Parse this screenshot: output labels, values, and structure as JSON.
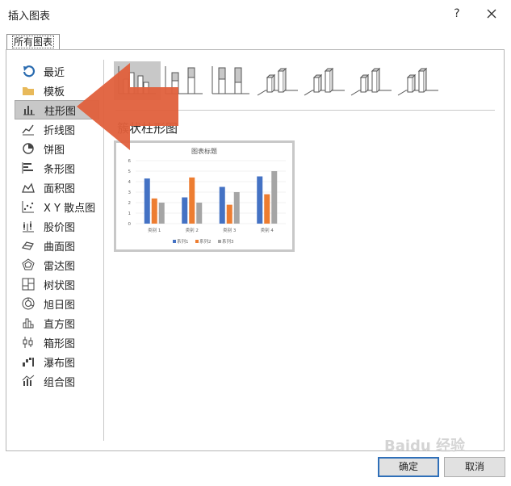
{
  "window": {
    "title": "插入图表",
    "help_label": "?"
  },
  "tabs": [
    {
      "label": "所有图表"
    }
  ],
  "sidebar": {
    "items": [
      {
        "label": "最近",
        "icon": "recent-icon"
      },
      {
        "label": "模板",
        "icon": "template-folder-icon"
      },
      {
        "label": "柱形图",
        "icon": "column-chart-icon",
        "selected": true
      },
      {
        "label": "折线图",
        "icon": "line-chart-icon"
      },
      {
        "label": "饼图",
        "icon": "pie-chart-icon"
      },
      {
        "label": "条形图",
        "icon": "bar-chart-icon"
      },
      {
        "label": "面积图",
        "icon": "area-chart-icon"
      },
      {
        "label": "X Y 散点图",
        "icon": "scatter-chart-icon"
      },
      {
        "label": "股价图",
        "icon": "stock-chart-icon"
      },
      {
        "label": "曲面图",
        "icon": "surface-chart-icon"
      },
      {
        "label": "雷达图",
        "icon": "radar-chart-icon"
      },
      {
        "label": "树状图",
        "icon": "treemap-chart-icon"
      },
      {
        "label": "旭日图",
        "icon": "sunburst-chart-icon"
      },
      {
        "label": "直方图",
        "icon": "histogram-chart-icon"
      },
      {
        "label": "箱形图",
        "icon": "box-whisker-chart-icon"
      },
      {
        "label": "瀑布图",
        "icon": "waterfall-chart-icon"
      },
      {
        "label": "组合图",
        "icon": "combo-chart-icon"
      }
    ]
  },
  "main": {
    "chart_type_title": "簇状柱形图",
    "subtypes": [
      {
        "name": "clustered-column",
        "selected": true
      },
      {
        "name": "stacked-column"
      },
      {
        "name": "100-stacked-column"
      },
      {
        "name": "3d-clustered-column"
      },
      {
        "name": "3d-stacked-column"
      },
      {
        "name": "3d-100-stacked-column"
      },
      {
        "name": "3d-column"
      }
    ]
  },
  "chart_data": {
    "type": "bar",
    "title": "图表标题",
    "categories": [
      "类别 1",
      "类别 2",
      "类别 3",
      "类别 4"
    ],
    "series": [
      {
        "name": "系列1",
        "values": [
          4.3,
          2.5,
          3.5,
          4.5
        ],
        "color": "#4472c4"
      },
      {
        "name": "系列2",
        "values": [
          2.4,
          4.4,
          1.8,
          2.8
        ],
        "color": "#ed7d31"
      },
      {
        "name": "系列3",
        "values": [
          2,
          2,
          3,
          5
        ],
        "color": "#a5a5a5"
      }
    ],
    "yticks": [
      "0",
      "1",
      "2",
      "3",
      "4",
      "5",
      "6"
    ],
    "ylim": [
      0,
      6
    ],
    "grid": true,
    "legend": "bottom"
  },
  "buttons": {
    "ok": "确定",
    "cancel": "取消"
  },
  "watermark": "Baidu 经验",
  "colors": {
    "arrow": "#e0603c",
    "accent": "#2f6fb8"
  }
}
